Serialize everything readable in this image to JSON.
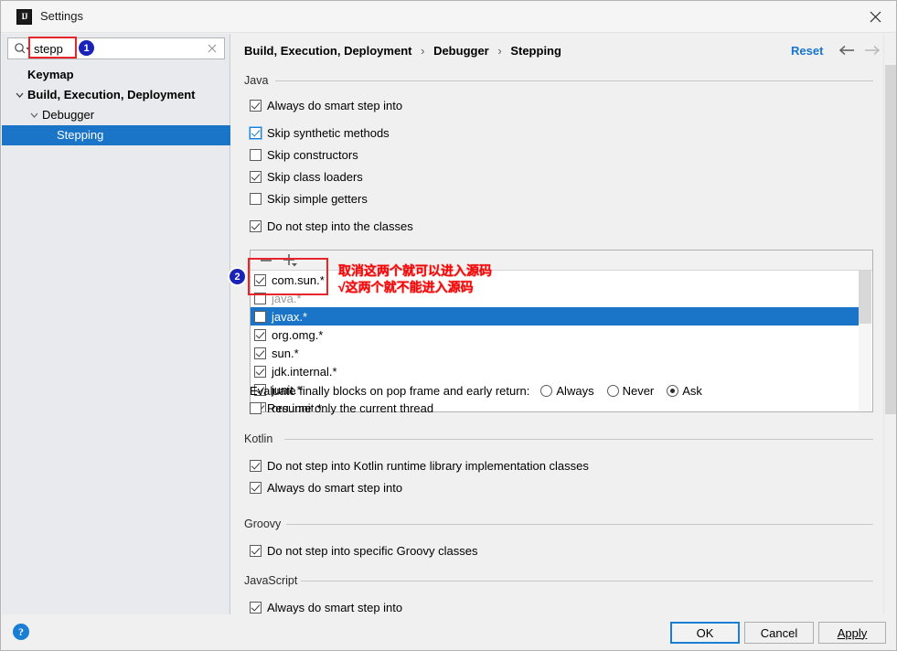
{
  "window": {
    "title": "Settings",
    "app_icon": "intellij-idea-icon",
    "close_label": "×"
  },
  "sidebar": {
    "search": {
      "value": "stepp",
      "placeholder": "Search settings",
      "icon": "search-icon",
      "clear_icon": "clear-icon"
    },
    "tree": [
      {
        "label": "Keymap",
        "level": 0,
        "expandable": false,
        "selected": false
      },
      {
        "label": "Build, Execution, Deployment",
        "level": 1,
        "expandable": true,
        "expanded": true,
        "selected": false
      },
      {
        "label": "Debugger",
        "level": 2,
        "expandable": true,
        "expanded": true,
        "selected": false
      },
      {
        "label": "Stepping",
        "level": 3,
        "expandable": false,
        "selected": true
      }
    ]
  },
  "main": {
    "breadcrumb": {
      "parts": [
        "Build, Execution, Deployment",
        "Debugger",
        "Stepping"
      ],
      "separator": "›"
    },
    "reset_label": "Reset",
    "nav_back_icon": "arrow-left-icon",
    "nav_forward_icon": "arrow-right-icon",
    "sections": {
      "java": "Java",
      "kotlin": "Kotlin",
      "groovy": "Groovy",
      "javascript": "JavaScript"
    },
    "java_options": [
      {
        "label": "Always do smart step into",
        "mnemonic": "l",
        "checked": true,
        "focused": false
      },
      {
        "label": "Skip synthetic methods",
        "mnemonic": "p",
        "checked": true,
        "focused": true
      },
      {
        "label": "Skip constructors",
        "mnemonic": "c",
        "checked": false,
        "focused": false
      },
      {
        "label": "Skip class loaders",
        "mnemonic": "o",
        "checked": true,
        "focused": false
      },
      {
        "label": "Skip simple getters",
        "mnemonic": "g",
        "checked": false,
        "focused": false
      },
      {
        "label": "Do not step into the classes",
        "mnemonic": "i",
        "checked": true,
        "focused": false
      }
    ],
    "class_list": {
      "toolbar": {
        "remove_icon": "minus-icon",
        "add_icon": "plus-dropdown-icon"
      },
      "rows": [
        {
          "label": "com.sun.*",
          "checked": true,
          "selected": false,
          "dim": false
        },
        {
          "label": "java.*",
          "checked": false,
          "selected": false,
          "dim": true
        },
        {
          "label": "javax.*",
          "checked": false,
          "selected": true,
          "dim": false
        },
        {
          "label": "org.omg.*",
          "checked": true,
          "selected": false,
          "dim": false
        },
        {
          "label": "sun.*",
          "checked": true,
          "selected": false,
          "dim": false
        },
        {
          "label": "jdk.internal.*",
          "checked": true,
          "selected": false,
          "dim": false
        },
        {
          "label": "junit.*",
          "checked": true,
          "selected": false,
          "dim": false
        },
        {
          "label": "org.junit.*",
          "checked": true,
          "selected": false,
          "dim": false
        }
      ]
    },
    "evaluate_finally": {
      "label": "Evaluate finally blocks on pop frame and early return:",
      "options": [
        {
          "label": "Always",
          "mnemonic": "A",
          "selected": false
        },
        {
          "label": "Never",
          "mnemonic": "e",
          "selected": false
        },
        {
          "label": "Ask",
          "mnemonic": "k",
          "selected": true
        }
      ]
    },
    "resume_option": {
      "label": "Resume only the current thread",
      "checked": false
    },
    "kotlin_options": [
      {
        "label": "Do not step into Kotlin runtime library implementation classes",
        "checked": true
      },
      {
        "label": "Always do smart step into",
        "checked": true
      }
    ],
    "groovy_options": [
      {
        "label": "Do not step into specific Groovy classes",
        "mnemonic": "i",
        "checked": true
      }
    ],
    "javascript_options": [
      {
        "label": "Always do smart step into",
        "checked": true
      }
    ]
  },
  "footer": {
    "help_label": "?",
    "ok_label": "OK",
    "cancel_label": "Cancel",
    "apply_label": "Apply"
  },
  "annotations": {
    "marker_1": "1",
    "marker_2": "2",
    "note_line1": "取消这两个就可以进入源码",
    "note_line2": "√这两个就不能进入源码",
    "color": "#f00c0c",
    "box_color": "#e8262a",
    "marker_color": "#1a23b8"
  }
}
